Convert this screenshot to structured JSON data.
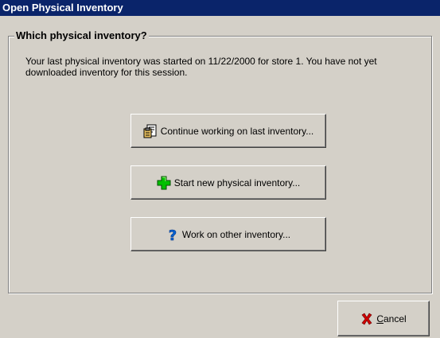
{
  "window": {
    "title": "Open Physical Inventory"
  },
  "group": {
    "legend": "Which physical inventory?",
    "message": "Your last physical inventory was started on 11/22/2000 for store 1. You have not yet downloaded inventory for this session."
  },
  "buttons": {
    "continue_label": "Continue working on last inventory...",
    "continue_icon": "document-clipboard-icon",
    "start_label": "Start new physical inventory...",
    "start_icon": "green-plus-icon",
    "work_label": "Work on other inventory...",
    "work_icon": "question-mark-icon",
    "cancel_label": "Cancel",
    "cancel_accelerator": "C",
    "cancel_rest": "ancel",
    "cancel_icon": "red-x-icon"
  },
  "colors": {
    "titlebar": "#0a246a",
    "window_bg": "#d4d0c8",
    "plus_green": "#00c000",
    "question_blue": "#0060d0",
    "x_red": "#d00000"
  }
}
